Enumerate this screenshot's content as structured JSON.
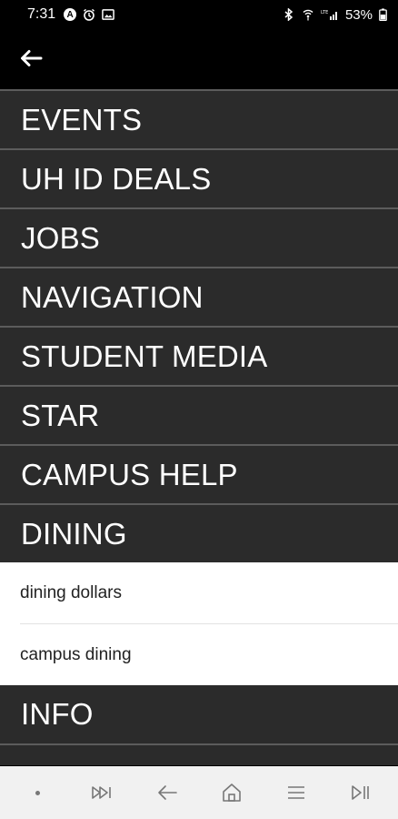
{
  "status_bar": {
    "time": "7:31",
    "battery_percent": "53%"
  },
  "menu": {
    "items": [
      {
        "label": "EVENTS"
      },
      {
        "label": "UH ID DEALS"
      },
      {
        "label": "JOBS"
      },
      {
        "label": "NAVIGATION"
      },
      {
        "label": "STUDENT MEDIA"
      },
      {
        "label": "STAR"
      },
      {
        "label": "CAMPUS HELP"
      },
      {
        "label": "DINING"
      }
    ],
    "dining_submenu": [
      {
        "label": "dining dollars"
      },
      {
        "label": "campus dining"
      }
    ],
    "after_items": [
      {
        "label": "INFO"
      }
    ]
  },
  "nav_bar": {
    "icons": [
      "dot-icon",
      "fast-forward-icon",
      "back-arrow-icon",
      "home-icon",
      "menu-icon",
      "play-pause-icon"
    ]
  },
  "colors": {
    "menu_background": "#2b2b2b",
    "menu_divider": "#5c5c5c",
    "submenu_background": "#ffffff",
    "app_bar_background": "#000000",
    "nav_bar_background": "#f1f1f1"
  }
}
